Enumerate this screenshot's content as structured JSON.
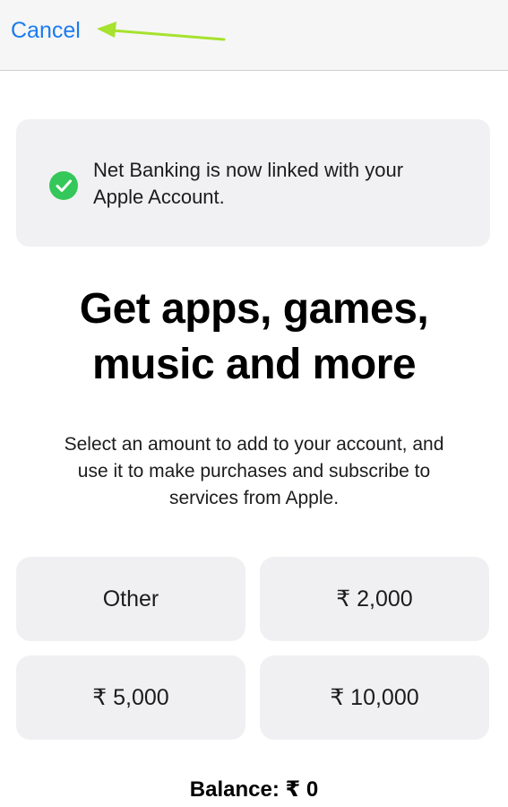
{
  "navbar": {
    "cancel_label": "Cancel"
  },
  "annotation": {
    "arrow_icon": "arrow-left-icon",
    "arrow_color": "#a6e22e"
  },
  "banner": {
    "icon": "checkmark-circle-icon",
    "icon_color": "#34c759",
    "line1": "Net Banking is now linked with your",
    "line2": "Apple Account."
  },
  "headline": {
    "line1": "Get apps, games,",
    "line2": "music and more"
  },
  "subtitle": {
    "line1": "Select an amount to add to your account, and",
    "line2": "use it to make purchases and subscribe to",
    "line3": "services from Apple."
  },
  "amounts": [
    {
      "label": "Other"
    },
    {
      "label": "₹ 2,000"
    },
    {
      "label": "₹ 5,000"
    },
    {
      "label": "₹ 10,000"
    }
  ],
  "balance": {
    "label": "Balance: ₹ 0"
  },
  "colors": {
    "accent": "#1a7cf0",
    "button_bg": "#f0f0f2",
    "navbar_bg": "#f6f6f6"
  }
}
